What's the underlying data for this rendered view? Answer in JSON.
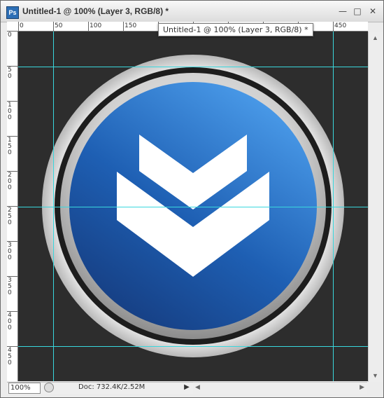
{
  "window": {
    "title": "Untitled-1 @ 100% (Layer 3, RGB/8) *",
    "controls": {
      "minimize": "—",
      "maximize": "□",
      "close": "✕"
    },
    "app_icon": "Ps"
  },
  "rulers": {
    "top_labels": [
      "0",
      "50",
      "100",
      "150",
      "450"
    ],
    "left_labels": [
      "0",
      "5 0",
      "1 0 0",
      "1 5 0",
      "2 0 0",
      "2 5 0",
      "3 0 0",
      "3 5 0",
      "4 0 0",
      "4 5 0"
    ]
  },
  "tooltip": {
    "text": "Untitled-1 @ 100% (Layer 3, RGB/8) *"
  },
  "status": {
    "zoom": "100%",
    "doc": "Doc: 732.4K/2.52M",
    "arrow": "▶"
  },
  "canvas": {
    "background": "#2d2d2d",
    "guide_color": "#39d7dd",
    "button_blue": "#1e5fb3",
    "button_highlight": "#4d9dec",
    "ring_color": "#cfcfcf",
    "chevron_color": "#ffffff",
    "icon": "double-chevron-down-icon"
  }
}
